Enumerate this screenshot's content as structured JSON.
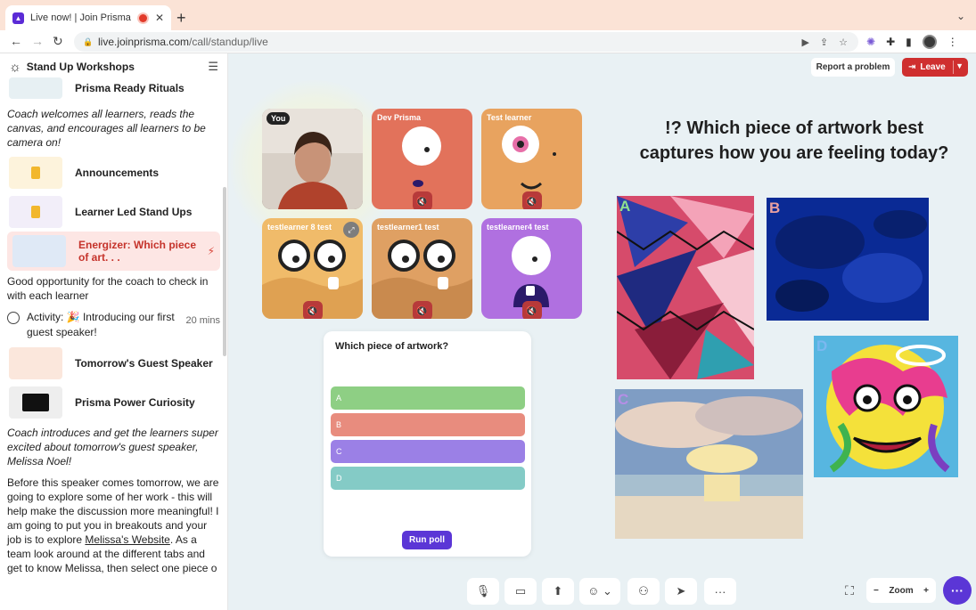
{
  "browser": {
    "tab_title": "Live now! | Join Prisma",
    "url_host": "live.joinprisma.com",
    "url_path": "/call/standup/live"
  },
  "sidebar": {
    "title": "Stand Up Workshops",
    "items": [
      {
        "label": "Prisma Ready Rituals"
      },
      {
        "label": "Announcements"
      },
      {
        "label": "Learner Led Stand Ups"
      },
      {
        "label": "Energizer: Which piece of art. . ."
      },
      {
        "label": "Tomorrow's Guest Speaker"
      },
      {
        "label": "Prisma Power Curiosity"
      }
    ],
    "note1": "Coach welcomes all learners, reads the canvas, and encourages all learners to be camera on!",
    "text1": "Good opportunity for the coach to check in with each learner",
    "activity_label": "Activity: 🎉 Introducing our first guest speaker!",
    "activity_mins": "20 mins",
    "note2": "Coach introduces and get the learners super excited about tomorrow's guest speaker, Melissa Noel!",
    "body_a": "Before this speaker comes tomorrow, we are going to explore some of her work - this will help make the discussion more meaningful! I am going to put you in breakouts and your job is to explore ",
    "body_link": "Melissa's Website",
    "body_b": ". As a team look around at the different tabs and get to know Melissa, then select one piece o"
  },
  "stage": {
    "report_label": "Report a problem",
    "leave_label": "Leave",
    "question": "!? Which piece of artwork best captures how you are feeling today?",
    "participants": [
      {
        "name": "You",
        "color": "#b57a55"
      },
      {
        "name": "Dev Prisma",
        "color": "#e2725b"
      },
      {
        "name": "Test learner",
        "color": "#e8a35f"
      },
      {
        "name": "testlearner 8 test",
        "color": "#f0bb6a"
      },
      {
        "name": "testlearner1 test",
        "color": "#dfa063"
      },
      {
        "name": "testlearner4 test",
        "color": "#b070e0"
      }
    ],
    "poll": {
      "question": "Which piece of artwork?",
      "options": [
        {
          "label": "A",
          "color": "#8ecf84"
        },
        {
          "label": "B",
          "color": "#e88c7e"
        },
        {
          "label": "C",
          "color": "#9b80e6"
        },
        {
          "label": "D",
          "color": "#84cbc6"
        }
      ],
      "run_label": "Run poll"
    },
    "art_labels": [
      "A",
      "B",
      "C",
      "D"
    ],
    "zoom_label": "Zoom"
  }
}
